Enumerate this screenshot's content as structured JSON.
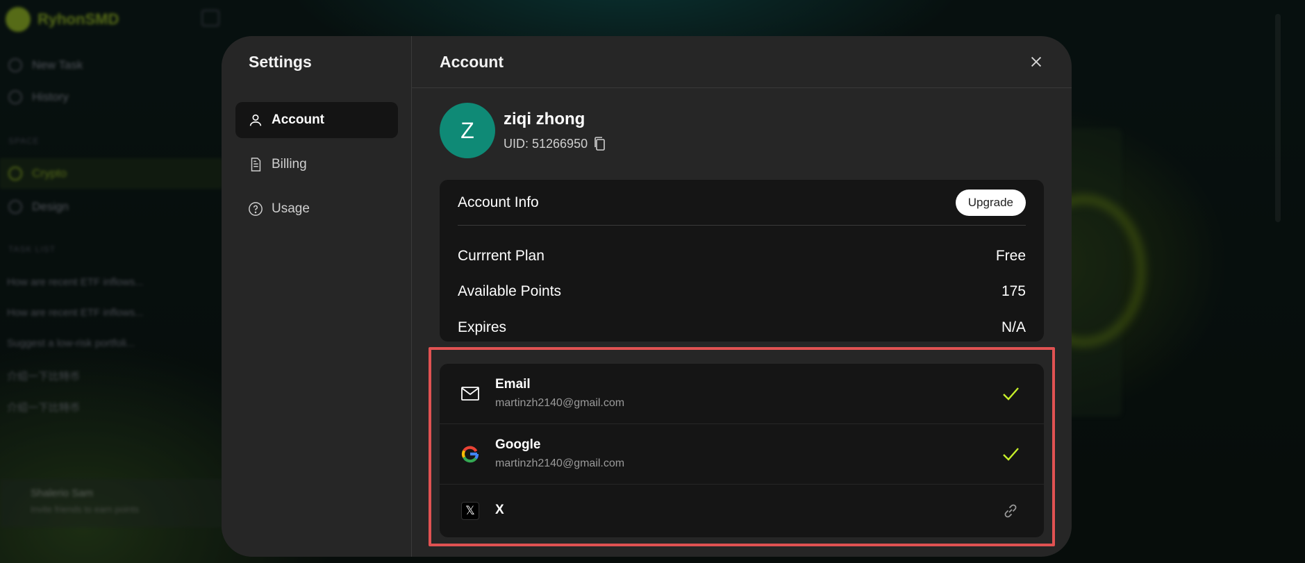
{
  "background_app": {
    "logo": "RyhonSMD",
    "nav": [
      "New Task",
      "History"
    ],
    "sections": [
      "SPACE",
      "TASK LIST"
    ],
    "spaces": [
      "Crypto",
      "Design"
    ],
    "tasks": [
      "How are recent ETF inflows...",
      "How are recent ETF inflows...",
      "Suggest a low-risk portfoli...",
      "介绍一下比特币",
      "介绍一下比特币"
    ],
    "user_name": "Shalerio Sam",
    "user_sub": "Invite friends to earn points"
  },
  "settings": {
    "title": "Settings",
    "nav": [
      {
        "label": "Account",
        "icon": "user-icon",
        "active": true
      },
      {
        "label": "Billing",
        "icon": "document-icon",
        "active": false
      },
      {
        "label": "Usage",
        "icon": "help-circle-icon",
        "active": false
      }
    ]
  },
  "account": {
    "title": "Account",
    "avatar_letter": "Z",
    "avatar_color": "#0f8a76",
    "name": "ziqi zhong",
    "uid": "UID: 51266950",
    "info": {
      "title": "Account Info",
      "upgrade_label": "Upgrade",
      "rows": [
        {
          "label": "Currrent Plan",
          "value": "Free"
        },
        {
          "label": "Available Points",
          "value": "175"
        },
        {
          "label": "Expires",
          "value": "N/A"
        }
      ]
    },
    "linked": [
      {
        "name": "Email",
        "email": "martinzh2140@gmail.com",
        "icon": "mail-icon",
        "status": "connected"
      },
      {
        "name": "Google",
        "email": "martinzh2140@gmail.com",
        "icon": "google-icon",
        "status": "connected"
      },
      {
        "name": "X",
        "email": "",
        "icon": "x-logo-icon",
        "status": "link"
      }
    ]
  },
  "colors": {
    "accent_check": "#c7ef2a",
    "highlight": "#e05252"
  }
}
